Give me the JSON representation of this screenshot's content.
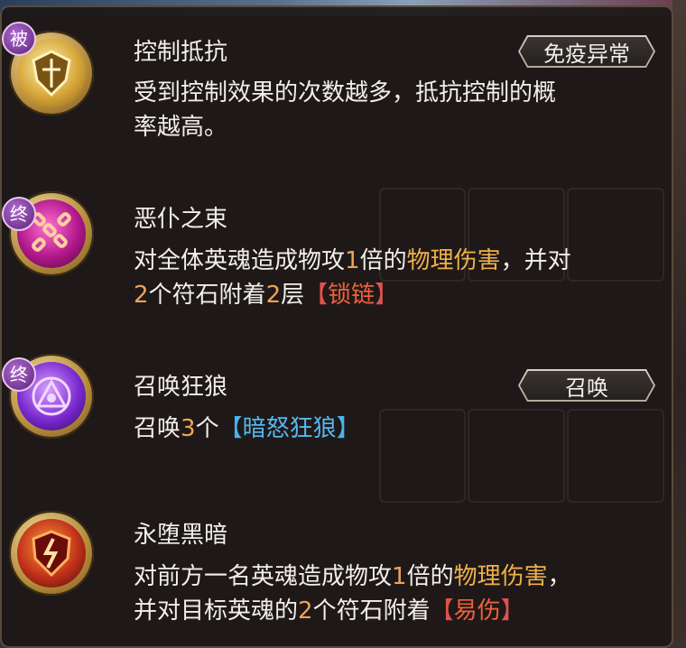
{
  "skills": [
    {
      "tag": "被",
      "icon": "shield-emblem-icon",
      "name": "控制抵抗",
      "badge": "免疫异常",
      "desc": [
        "受到控制效果的次数越多，抵抗控制的概",
        "率越高。"
      ]
    },
    {
      "tag": "终",
      "icon": "chain-cross-icon",
      "name": "恶仆之束",
      "desc1": {
        "a": "对全体英魂造成物攻",
        "n": "1",
        "b": "倍的",
        "dmg": "物理伤害",
        "c": "，并对"
      },
      "desc2": {
        "n1": "2",
        "a": "个符石附着",
        "n2": "2",
        "b": "层",
        "lb": "【",
        "term": "锁链",
        "rb": "】"
      }
    },
    {
      "tag": "终",
      "icon": "summon-sigil-icon",
      "name": "召唤狂狼",
      "badge": "召唤",
      "desc1": {
        "a": "召唤",
        "n": "3",
        "b": "个",
        "lb": "【",
        "term": "暗怒狂狼",
        "rb": "】"
      }
    },
    {
      "icon": "cracked-shield-icon",
      "name": "永堕黑暗",
      "desc1": {
        "a": "对前方一名英魂造成物攻",
        "n": "1",
        "b": "倍的",
        "dmg": "物理伤害",
        "c": "，"
      },
      "desc2": {
        "a": "并对目标英魂的",
        "n": "2",
        "b": "个符石附着",
        "lb": "【",
        "term": "易伤",
        "rb": "】"
      }
    }
  ],
  "colors": {
    "number": "#f0a25a",
    "damage": "#f0b04a",
    "bracket_red": "#e0524b",
    "bracket_blue": "#4ab2ee"
  }
}
